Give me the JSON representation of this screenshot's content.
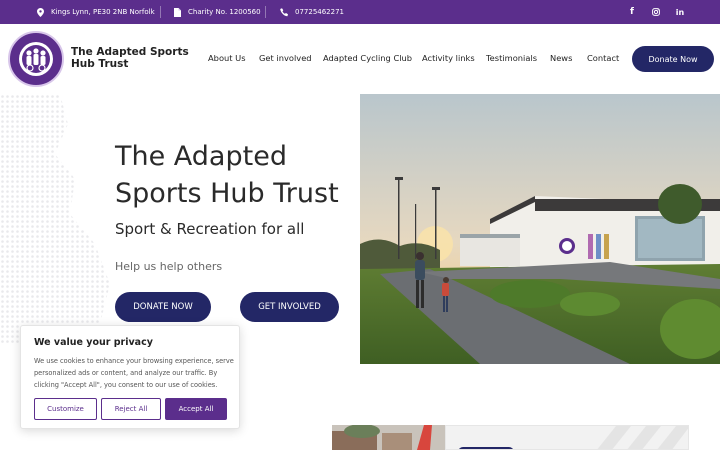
{
  "topbar": {
    "address": "Kings Lynn, PE30 2NB Norfolk",
    "charity": "Charity No. 1200560",
    "phone": "07725462271",
    "social": [
      "f",
      "instagram",
      "in"
    ]
  },
  "brand": {
    "name": "The Adapted Sports Hub Trust",
    "logo_icon": "trust-logo-badge"
  },
  "nav": {
    "items": [
      "About Us",
      "Get involved",
      "Adapted Cycling Club",
      "Activity links",
      "Testimonials",
      "News",
      "Contact"
    ],
    "donate": "Donate Now"
  },
  "hero": {
    "title": "The Adapted Sports Hub Trust",
    "subtitle": "Sport & Recreation for all",
    "tagline": "Help us help others",
    "btn_donate": "DONATE NOW",
    "btn_involved": "GET INVOLVED"
  },
  "cookie": {
    "title": "We value your privacy",
    "body": "We use cookies to enhance your browsing experience, serve personalized ads or content, and analyze our traffic. By clicking \"Accept All\", you consent to our use of cookies.",
    "customize": "Customize",
    "reject": "Reject All",
    "accept": "Accept All"
  },
  "colors": {
    "purple": "#5b2e8c",
    "navy": "#232766"
  }
}
